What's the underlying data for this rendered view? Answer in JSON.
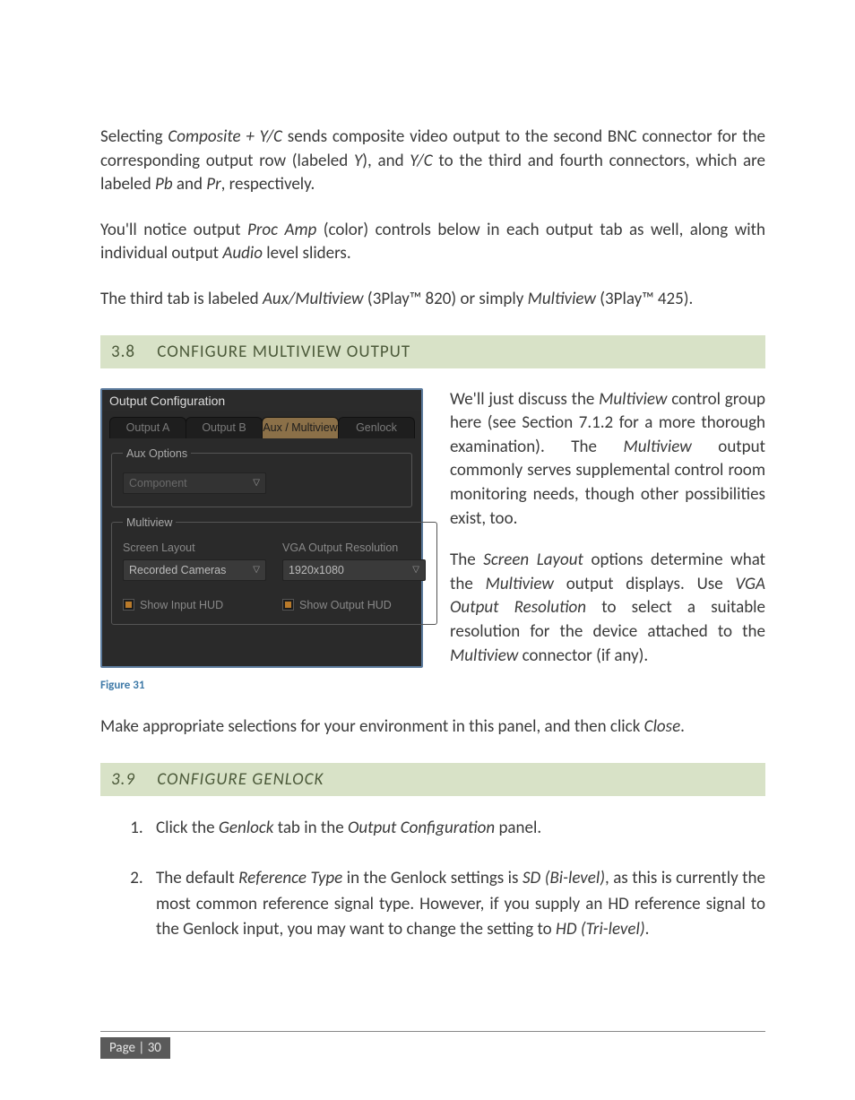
{
  "para1": {
    "pre": "Selecting ",
    "em1": "Composite + Y/C",
    "mid1": " sends composite video output to the second BNC connector for the corresponding output row (labeled ",
    "em2": "Y",
    "mid2": "), and ",
    "em3": "Y/C",
    "mid3": " to the third and fourth connectors, which are labeled ",
    "em4": "Pb",
    "mid4": " and ",
    "em5": "Pr",
    "tail": ", respectively."
  },
  "para2": {
    "pre": "You'll notice output ",
    "em1": "Proc Amp",
    "mid1": " (color) controls below in each output tab as well, along with individual output ",
    "em2": "Audio",
    "tail": " level sliders."
  },
  "para3": {
    "pre": "The third tab is labeled ",
    "em1": "Aux/Multiview",
    "mid1": " (3Play™ 820) or simply ",
    "em2": "Multiview",
    "tail": " (3Play™ 425)."
  },
  "headings": {
    "h38_num": "3.8",
    "h38_text": "CONFIGURE MULTIVIEW OUTPUT",
    "h39_num": "3.9",
    "h39_text": "CONFIGURE GENLOCK"
  },
  "panel": {
    "title": "Output Configuration",
    "tabs": {
      "a": "Output A",
      "b": "Output B",
      "aux": "Aux / Multiview",
      "genlock": "Genlock"
    },
    "aux_legend": "Aux Options",
    "aux_dropdown": "Component",
    "mv_legend": "Multiview",
    "screen_layout_label": "Screen Layout",
    "screen_layout_value": "Recorded Cameras",
    "vga_label": "VGA Output Resolution",
    "vga_value": "1920x1080",
    "show_input_hud": "Show Input HUD",
    "show_output_hud": "Show Output HUD"
  },
  "figure_caption": "Figure 31",
  "right_p1": {
    "pre": "We'll just discuss the ",
    "em1": "Multiview",
    "mid1": " control group here (see Section 7.1.2 for a more thorough examination). The ",
    "em2": "Multiview",
    "tail": " output commonly serves supplemental control room monitoring needs, though other possibilities exist, too."
  },
  "right_p2": {
    "pre": "The ",
    "em1": "Screen Layout",
    "mid1": " options determine what the ",
    "em2": "Multiview",
    "mid2": " output displays.  Use ",
    "em3": "VGA Output Resolution",
    "mid3": " to select a suitable resolution for the device attached to the ",
    "em4": "Multiview",
    "tail": " connector (if any)."
  },
  "para_close": {
    "pre": "Make appropriate selections for your environment in this panel, and then click ",
    "em1": "Close",
    "tail": "."
  },
  "steps": {
    "s1": {
      "pre": "Click the ",
      "em1": "Genlock",
      "mid": " tab in the ",
      "em2": "Output Configuration",
      "tail": " panel."
    },
    "s2": {
      "pre": "The default ",
      "em1": "Reference Type",
      "mid1": " in the Genlock settings is ",
      "em2": "SD (Bi-level)",
      "mid2": ", as this is currently the most common reference signal type.  However, if you supply an HD reference signal to the Genlock input, you may want to change the setting to ",
      "em3": "HD (Tri-level)",
      "tail": "."
    }
  },
  "footer": {
    "label": "Page | 30"
  }
}
